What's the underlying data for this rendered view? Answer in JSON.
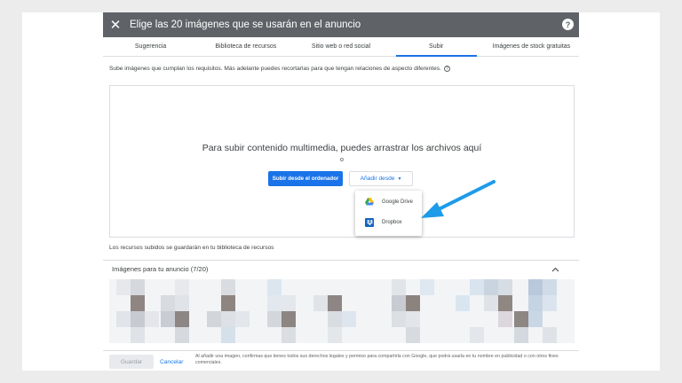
{
  "dialog": {
    "title": "Elige las 20 imágenes que se usarán en el anuncio",
    "close_icon": "close-icon",
    "help_icon": "help-icon",
    "help_glyph": "?"
  },
  "tabs": [
    {
      "label": "Sugerencia",
      "active": false
    },
    {
      "label": "Biblioteca de recursos",
      "active": false
    },
    {
      "label": "Sitio web o red social",
      "active": false
    },
    {
      "label": "Subir",
      "active": true
    },
    {
      "label": "Imágenes de stock gratuitas",
      "active": false
    }
  ],
  "upload": {
    "instructions": "Sube imágenes que cumplan los requisitos. Más adelante puedes recortarlas para que tengan relaciones de aspecto diferentes.",
    "drop_text": "Para subir contenido multimedia, puedes arrastrar los archivos aquí",
    "or_text": "o",
    "upload_button": "Subir desde el ordenador",
    "add_from_button": "Añadir desde",
    "menu_items": [
      {
        "label": "Google Drive",
        "icon": "google-drive-icon"
      },
      {
        "label": "Dropbox",
        "icon": "dropbox-icon"
      }
    ],
    "stored_note": "Los recursos subidos se guardarán en tu biblioteca de recursos"
  },
  "images": {
    "header": "Imágenes para tu anuncio (7/20)"
  },
  "footer": {
    "save_label": "Guardar",
    "cancel_label": "Cancelar",
    "legal_text": "Al añadir una imagen, confirmas que tienes todos sus derechos legales y permiso para compartirla con Google, que podrá usarla en tu nombre en publicidad o con otros fines comerciales."
  },
  "colors": {
    "header_bg": "#5f6368",
    "accent": "#1a73e8",
    "annotation_arrow": "#1e9be9"
  }
}
